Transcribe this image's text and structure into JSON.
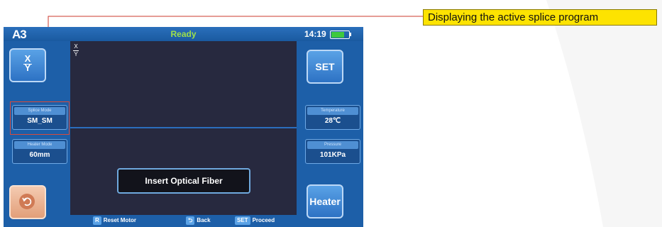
{
  "callout": {
    "text": "Displaying the active splice program"
  },
  "device": {
    "logo": "A3",
    "status": "Ready",
    "time": "14:19",
    "xy_button": {
      "x": "X",
      "y": "Y"
    },
    "screen_axis": {
      "x": "X",
      "y": "Y"
    },
    "set_button": "SET",
    "heater_button": "Heater",
    "back_button_icon": "undo-arrow-icon",
    "splice_mode": {
      "label": "Splice Mode",
      "value": "SM_SM"
    },
    "heater_mode": {
      "label": "Heater Mode",
      "value": "60mm"
    },
    "temperature": {
      "label": "Temperature",
      "value": "28℃"
    },
    "pressure": {
      "label": "Pressure",
      "value": "101KPa"
    },
    "message": "Insert Optical Fiber",
    "hints": [
      {
        "key": "R",
        "label": "Reset Motor"
      },
      {
        "key": "⮌",
        "label": "Back"
      },
      {
        "key": "SET",
        "label": "Proceed"
      }
    ],
    "colors": {
      "status": "#9fe04a",
      "battery": "#3ec93e",
      "highlight": "#d94a3a",
      "callout": "#fde301"
    }
  }
}
